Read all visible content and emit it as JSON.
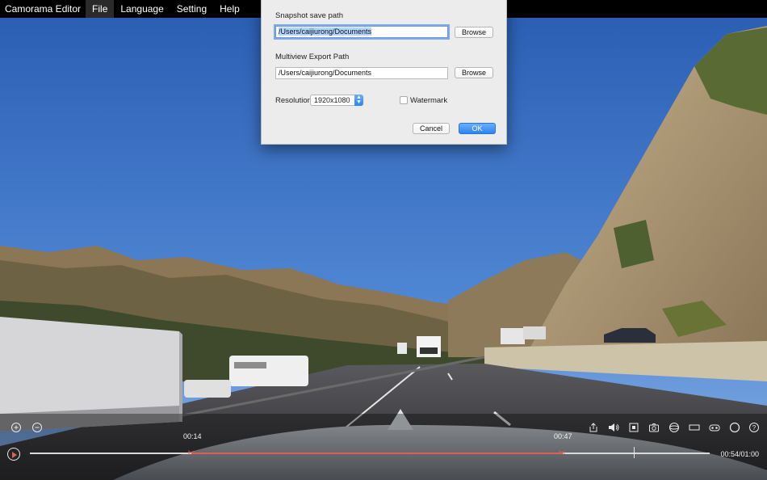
{
  "menubar": {
    "app_name": "Camorama Editor",
    "menus": [
      "File",
      "Language",
      "Setting",
      "Help"
    ]
  },
  "dialog": {
    "snapshot_label": "Snapshot save path",
    "snapshot_path": "/Users/caijiurong/Documents",
    "browse_label": "Browse",
    "multiview_label": "Multiview Export Path",
    "multiview_path": "/Users/caijiurong/Documents",
    "resolution_label": "Resolution",
    "resolution_value": "1920x1080",
    "watermark_label": "Watermark",
    "watermark_checked": false,
    "cancel_label": "Cancel",
    "ok_label": "OK",
    "accent_color": "#2d84f2"
  },
  "player": {
    "clip_start": "00:14",
    "clip_end": "00:47",
    "duration": "00:54/01:00",
    "marker_color": "#e06050",
    "icons": [
      "zoom-in-icon",
      "zoom-out-icon",
      "export-icon",
      "volume-icon",
      "square-view-icon",
      "camera-icon",
      "sphere-icon",
      "panorama-icon",
      "vr-icon",
      "circle-icon",
      "help-icon"
    ]
  }
}
